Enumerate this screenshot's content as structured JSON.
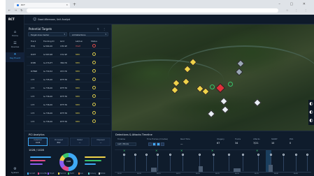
{
  "browser": {
    "tab_title": "RCT",
    "new_tab": "+",
    "nav": "← → ↻",
    "tools": "☆ ⋮ ⋮",
    "window_controls": "– ▢ ✕"
  },
  "app": {
    "logo": "RCT",
    "greeting": "Good Afternoon, Unit Analyst"
  },
  "rail": [
    {
      "icon": "⌂",
      "label": "Home"
    },
    {
      "icon": "☰",
      "label": "Queries"
    },
    {
      "icon": "✦",
      "label": "Key Event"
    }
  ],
  "rail_bottom": {
    "icon": "⚙",
    "label": "System"
  },
  "targets": {
    "title": "Potential Targets",
    "filter_a": "Target Area Center",
    "filter_b": "All Detections",
    "columns": [
      "Track",
      "Tracking ID",
      "Grid",
      "Lat/Lon",
      "Status"
    ],
    "rows": [
      {
        "c1": "HVQ",
        "c2": "G-564-00",
        "c3": "135-SE",
        "c4": "HIGH",
        "s": "red"
      },
      {
        "c1": "R43T",
        "c2": "G-563-98",
        "c3": "131-SE",
        "c4": "MED",
        "s": "yellow"
      },
      {
        "c1": "R3P0",
        "c2": "G-274-PT",
        "c3": "384-TR",
        "c4": "MED",
        "s": "yellow"
      },
      {
        "c1": "R7898",
        "c2": "G-730-52",
        "c3": "037-TR",
        "c4": "MED",
        "s": "yellow"
      },
      {
        "c1": "173",
        "c2": "G-735-00",
        "c3": "DTF-TR",
        "c4": "MED",
        "s": "yellow"
      },
      {
        "c1": "173",
        "c2": "G-736-00",
        "c3": "DTF-TR",
        "c4": "MED",
        "s": "yellow"
      },
      {
        "c1": "173",
        "c2": "G-736-00",
        "c3": "DTF-TR",
        "c4": "MED",
        "s": "yellow"
      },
      {
        "c1": "173",
        "c2": "G-736-00",
        "c3": "DTF-TR",
        "c4": "MED",
        "s": "yellow"
      },
      {
        "c1": "173",
        "c2": "G-736-00",
        "c3": "DTF-TR",
        "c4": "MED",
        "s": "yellow"
      },
      {
        "c1": "173",
        "c2": "G-736-00",
        "c3": "DTF-TR",
        "c4": "MED",
        "s": "yellow"
      }
    ]
  },
  "analytics": {
    "title": "PCI Analytics",
    "kpis": [
      {
        "label": "Detected",
        "value": "1028"
      },
      {
        "label": "Processed",
        "value": "862"
      },
      {
        "label": "Stated",
        "value": "—"
      },
      {
        "label": "Disposed",
        "value": "—"
      }
    ],
    "count": "1028 / 1028",
    "center": "1028",
    "legend": [
      "Aircraft",
      "Armor/BG",
      "Emplt",
      "Field Ctr",
      "Fortif",
      "Gun",
      "Convoy",
      "ExtrGt"
    ]
  },
  "timeline": {
    "title": "Detections & Attacks Timeline",
    "timeline_label": "Timeline",
    "range_label": "Last x Minute",
    "frames_label": "Time Frames (minutes)",
    "read_time_label": "Read Time",
    "read_time": "—",
    "stats": [
      {
        "label": "Imagery",
        "value": "67"
      },
      {
        "label": "Tracks",
        "value": "34"
      },
      {
        "label": "Attacks",
        "value": "7/21"
      },
      {
        "label": "SIGINT",
        "value": "10"
      },
      {
        "label": "PDA",
        "value": "0"
      }
    ],
    "ticks": [
      "06:00",
      "06:05",
      "06:10",
      "06:15",
      "06:20",
      "06:25",
      "06:30",
      "06:35",
      "06:40",
      "06:45"
    ]
  }
}
